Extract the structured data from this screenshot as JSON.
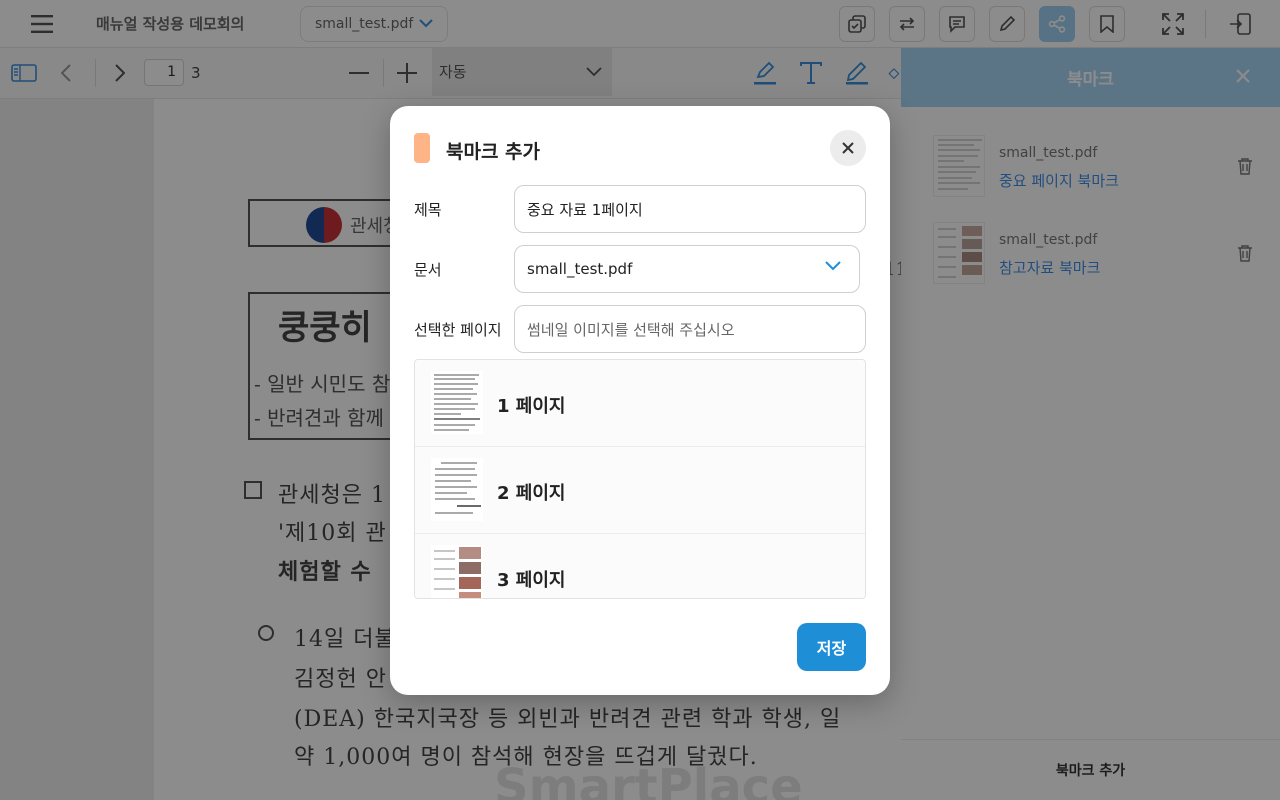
{
  "topbar": {
    "title": "매뉴얼 작성용 데모회의",
    "file_name": "small_test.pdf",
    "tools": [
      "copy-icon",
      "swap-icon",
      "comment-icon",
      "pen-icon",
      "share-icon",
      "bookmark-icon",
      "fullscreen-icon",
      "exit-icon"
    ],
    "active_tool": "share-icon"
  },
  "toolbar2": {
    "current_page": "1",
    "total_pages": "3",
    "zoom": "자동"
  },
  "document": {
    "org": "관세청",
    "headline": "쿵쿵히",
    "bullets": [
      "- 일반 시민도 참",
      "- 반려견과 함께"
    ],
    "para1": "관세청은 1",
    "para1b": "'제10회 관",
    "para1c": "체험할 수",
    "para2a": "14일 더불",
    "para2b": "김정헌 안",
    "para2c": "(DEA) 한국지국장 등 외빈과 반려견 관련 학과 학생, 일",
    "para2d": "약 1,000여 명이 참석해 현장을 뜨겁게 달궜다.",
    "watermark": "SmartPlace"
  },
  "panel": {
    "title": "북마크",
    "bookmarks": [
      {
        "file": "small_test.pdf",
        "name": "중요 페이지 북마크"
      },
      {
        "file": "small_test.pdf",
        "name": "참고자료 북마크"
      }
    ],
    "add_label": "북마크 추가"
  },
  "modal": {
    "title": "북마크 추가",
    "title_label": "제목",
    "title_value": "중요 자료 1페이지",
    "doc_label": "문서",
    "doc_value": "small_test.pdf",
    "page_label": "선택한 페이지",
    "page_placeholder": "썸네일 이미지를 선택해 주십시오",
    "pages": [
      {
        "label": "1 페이지"
      },
      {
        "label": "2 페이지"
      },
      {
        "label": "3 페이지"
      }
    ],
    "save_label": "저장"
  },
  "colors": {
    "accent": "#1e8ed6",
    "panel_header": "#a8d6f5",
    "modal_accent": "#ffb487",
    "bookmark_link": "#3f8ee8"
  }
}
